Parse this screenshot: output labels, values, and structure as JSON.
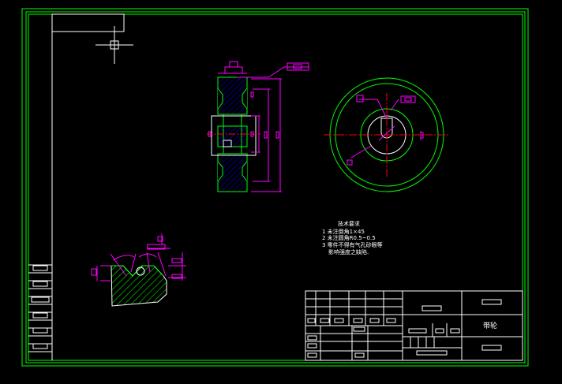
{
  "colors": {
    "background": "#000000",
    "frame": "#00ff00",
    "linework": "#ffffff",
    "dimensions": "#ff00ff",
    "centerline": "#ff0000",
    "hatch": "#0000ff",
    "tolerance_cyan": "#00ffff"
  },
  "tech_req": {
    "title": "技术要求",
    "line1": "1 未注倒角1×45",
    "line2": "2 未注圆角R0.5~0.5",
    "line3": "3 零件不得有气孔砂眼等",
    "line4": "影响强度之缺陷."
  },
  "title_block": {
    "part_name": "带轮"
  },
  "icons": {
    "cursor": "crosshair-cursor-icon"
  }
}
